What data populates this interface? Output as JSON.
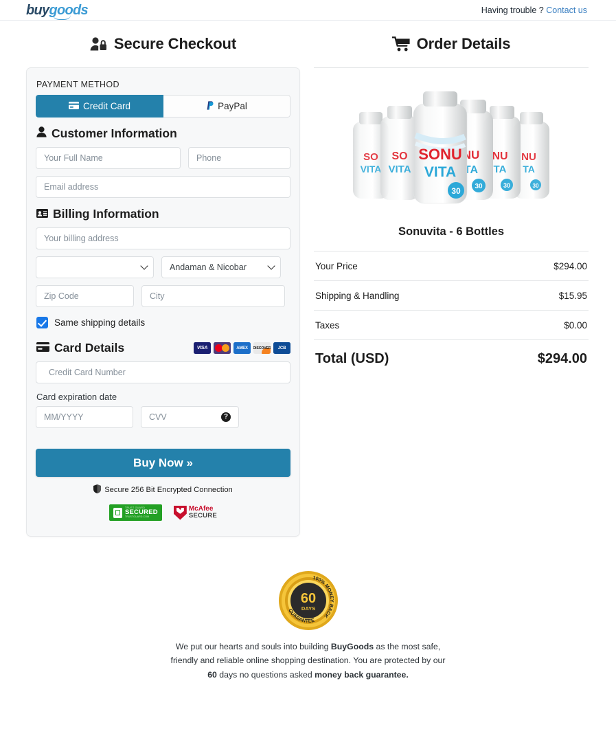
{
  "topbar": {
    "logo_buy": "buy",
    "logo_goods": "goods",
    "trouble_text": "Having trouble ?",
    "contact_link": "Contact us"
  },
  "checkout": {
    "title": "Secure Checkout",
    "payment_method_label": "PAYMENT METHOD",
    "tabs": [
      {
        "label": "Credit Card",
        "active": true
      },
      {
        "label": "PayPal",
        "active": false
      }
    ],
    "customer_section": "Customer Information",
    "fields": {
      "full_name_placeholder": "Your Full Name",
      "full_name_value": "",
      "phone_placeholder": "Phone",
      "phone_value": "",
      "email_placeholder": "Email address",
      "email_value": ""
    },
    "billing_section": "Billing Information",
    "billing": {
      "address_placeholder": "Your billing address",
      "address_value": "",
      "country_value": "",
      "state_value": "Andaman & Nicobar",
      "zip_placeholder": "Zip Code",
      "zip_value": "",
      "city_placeholder": "City",
      "city_value": ""
    },
    "same_shipping_label": "Same shipping details",
    "same_shipping_checked": true,
    "card_section": "Card Details",
    "card_brands": [
      "VISA",
      "Mastercard",
      "AMEX",
      "DISCOVER",
      "JCB"
    ],
    "card": {
      "number_placeholder": "Credit Card Number",
      "number_value": "",
      "expiration_label": "Card expiration date",
      "expiration_placeholder": "MM/YYYY",
      "expiration_value": "",
      "cvv_placeholder": "CVV",
      "cvv_value": ""
    },
    "buy_button": "Buy Now »",
    "encryption_note": "Secure 256 Bit Encrypted Connection",
    "trust_badges": {
      "trustguard_top": "TRUST GUARD",
      "trustguard_main": "SECURED",
      "trustguard_bottom": "TRUSTGUARD.COM",
      "mcafee_top": "McAfee",
      "mcafee_bottom": "SECURE"
    }
  },
  "order": {
    "title": "Order Details",
    "product_name": "Sonuvita - 6 Bottles",
    "product_label_top": "SONU",
    "product_label_bottom": "VITA",
    "product_badge": "30",
    "lines": [
      {
        "label": "Your Price",
        "amount": "$294.00"
      },
      {
        "label": "Shipping & Handling",
        "amount": "$15.95"
      },
      {
        "label": "Taxes",
        "amount": "$0.00"
      }
    ],
    "total_label": "Total (USD)",
    "total_amount": "$294.00"
  },
  "footer": {
    "seal_percent": "100% MONEY BACK",
    "seal_days": "60",
    "seal_days_label": "DAYS",
    "seal_guarantee": "GUARANTEE",
    "text_1": "We put our hearts and souls into building ",
    "brand": "BuyGoods",
    "text_2": " as the most safe, friendly and reliable online shopping destination. You are protected by our ",
    "days": "60",
    "text_3": " days no questions asked ",
    "guarantee": "money back guarantee."
  },
  "colors": {
    "accent_blue": "#2481ab",
    "checkbox_blue": "#1878e8",
    "link_blue": "#3a7fc1",
    "card_bg": "#f7f8f9"
  }
}
